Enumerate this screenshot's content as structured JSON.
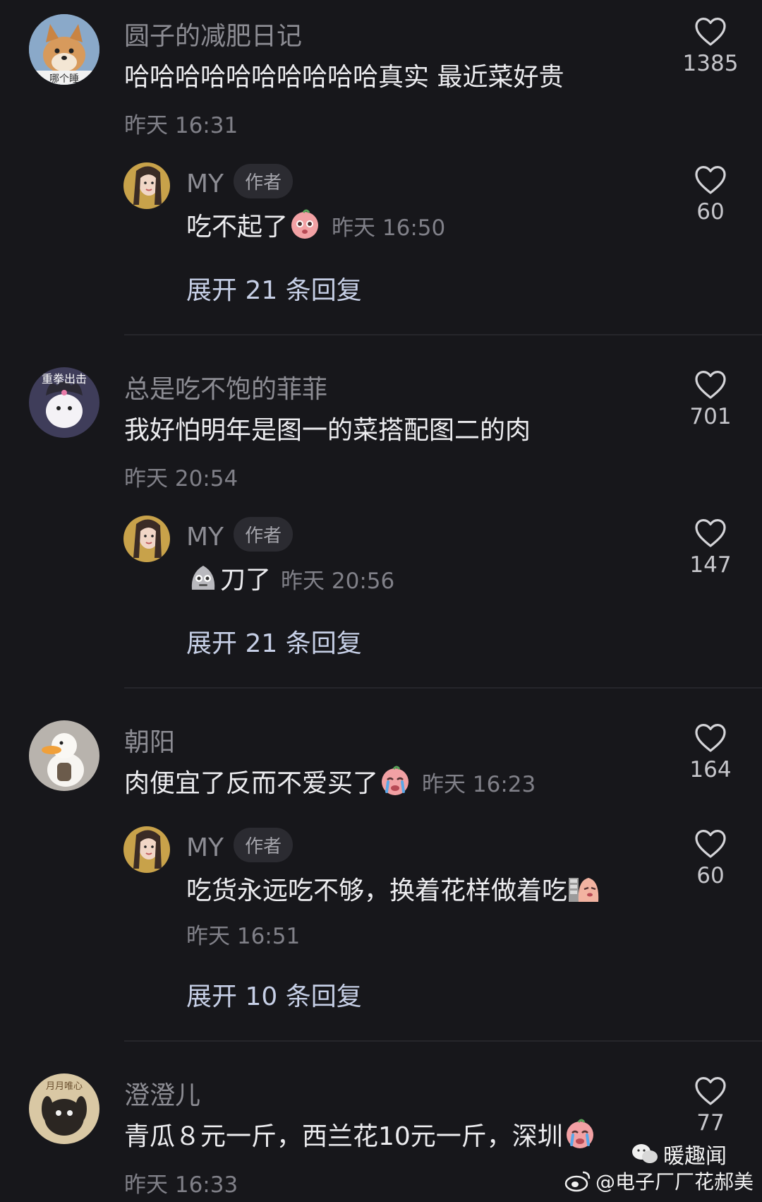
{
  "comments": [
    {
      "user": "圆子的减肥日记",
      "text": "哈哈哈哈哈哈哈哈哈哈真实 最近菜好贵",
      "time": "昨天 16:31",
      "likes": "1385",
      "avatar_caption": "哪个睡",
      "reply": {
        "user": "MY",
        "tag": "作者",
        "text": "吃不起了",
        "time": "昨天 16:50",
        "likes": "60"
      },
      "expand": "展开 21 条回复"
    },
    {
      "user": "总是吃不饱的菲菲",
      "text": "我好怕明年是图一的菜搭配图二的肉",
      "time": "昨天 20:54",
      "likes": "701",
      "avatar_caption": "重拳出击",
      "reply": {
        "user": "MY",
        "tag": "作者",
        "text": "刀了",
        "time": "昨天 20:56",
        "likes": "147"
      },
      "expand": "展开 21 条回复"
    },
    {
      "user": "朝阳",
      "text": "肉便宜了反而不爱买了",
      "time": "昨天 16:23",
      "likes": "164",
      "reply": {
        "user": "MY",
        "tag": "作者",
        "text": "吃货永远吃不够，换着花样做着吃",
        "time": "昨天 16:51",
        "likes": "60"
      },
      "expand": "展开 10 条回复"
    },
    {
      "user": "澄澄儿",
      "text": "青瓜８元一斤，西兰花10元一斤，深圳",
      "time": "昨天 16:33",
      "likes": "77",
      "avatar_caption": "月月唯心"
    }
  ],
  "watermark": {
    "account": "暖趣闻",
    "weibo": "@电子厂厂花郝美"
  },
  "icons": {
    "like": "heart-outline-icon",
    "weibo": "weibo-icon",
    "wechat": "wechat-icon"
  },
  "colors": {
    "background": "#17171b",
    "name": "#8c8c93",
    "text": "#ececef",
    "expand": "#c6cfe6"
  }
}
